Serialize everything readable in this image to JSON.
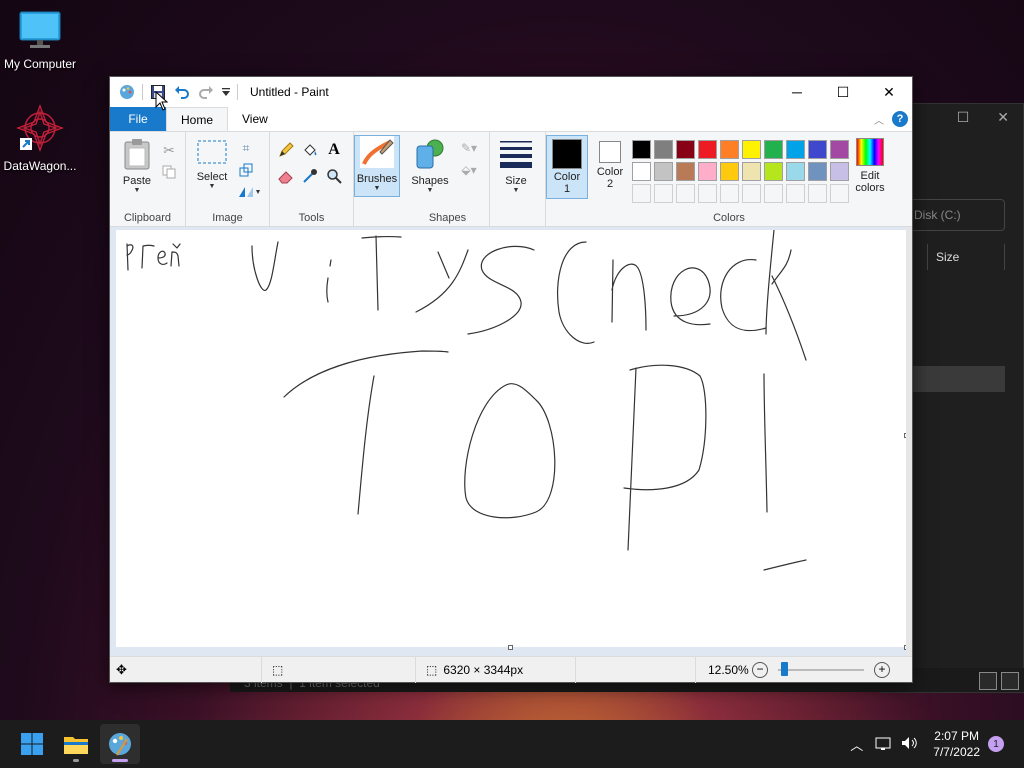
{
  "desktop": {
    "icons": [
      {
        "label": "My Computer",
        "icon": "monitor-icon"
      },
      {
        "label": "DataWagon...",
        "icon": "datawagon-app-icon"
      }
    ]
  },
  "background_window": {
    "search_field": "Disk (C:)",
    "column_header": "Size",
    "status_items": "3 items",
    "status_selected": "1 item selected"
  },
  "paint": {
    "title": "Untitled - Paint",
    "quick_access": [
      "paint-app-icon",
      "save-icon",
      "undo-icon",
      "redo-icon",
      "customize-dropdown-icon"
    ],
    "window_controls": {
      "minimize": "─",
      "maximize": "☐",
      "close": "✕"
    },
    "tabs": [
      {
        "label": "File"
      },
      {
        "label": "Home"
      },
      {
        "label": "View"
      }
    ],
    "ribbon": {
      "clipboard": {
        "paste_label": "Paste",
        "group_label": "Clipboard"
      },
      "image": {
        "select_label": "Select",
        "group_label": "Image"
      },
      "tools": {
        "group_label": "Tools"
      },
      "brushes": {
        "label": "Brushes"
      },
      "shapes": {
        "label": "Shapes",
        "group_label": "Shapes"
      },
      "size": {
        "label": "Size"
      },
      "colors": {
        "color1_label": "Color",
        "color1_num": "1",
        "color2_label": "Color",
        "color2_num": "2",
        "edit_label_1": "Edit",
        "edit_label_2": "colors",
        "group_label": "Colors",
        "color1": "#000000",
        "color2": "#ffffff",
        "palette_row1": [
          "#000000",
          "#7f7f7f",
          "#880015",
          "#ed1c24",
          "#ff7f27",
          "#fff200",
          "#22b14c",
          "#00a2e8",
          "#3f48cc",
          "#a349a4"
        ],
        "palette_row2": [
          "#ffffff",
          "#c3c3c3",
          "#b97a57",
          "#ffaec9",
          "#ffc90e",
          "#efe4b0",
          "#b5e61d",
          "#99d9ea",
          "#7092be",
          "#c8bfe7"
        ]
      }
    },
    "canvas_text_strokes": [
      "RΓeŇ",
      "u i T y s c h e c k",
      "T O P !"
    ],
    "status": {
      "dimensions": "6320 × 3344px",
      "zoom": "12.50%",
      "zoom_level": 0.125
    }
  },
  "taskbar": {
    "apps": [
      "start-icon",
      "file-explorer-icon",
      "paint-icon"
    ],
    "time": "2:07 PM",
    "date": "7/7/2022",
    "notifications": "1",
    "accent": "#c59ff0"
  }
}
